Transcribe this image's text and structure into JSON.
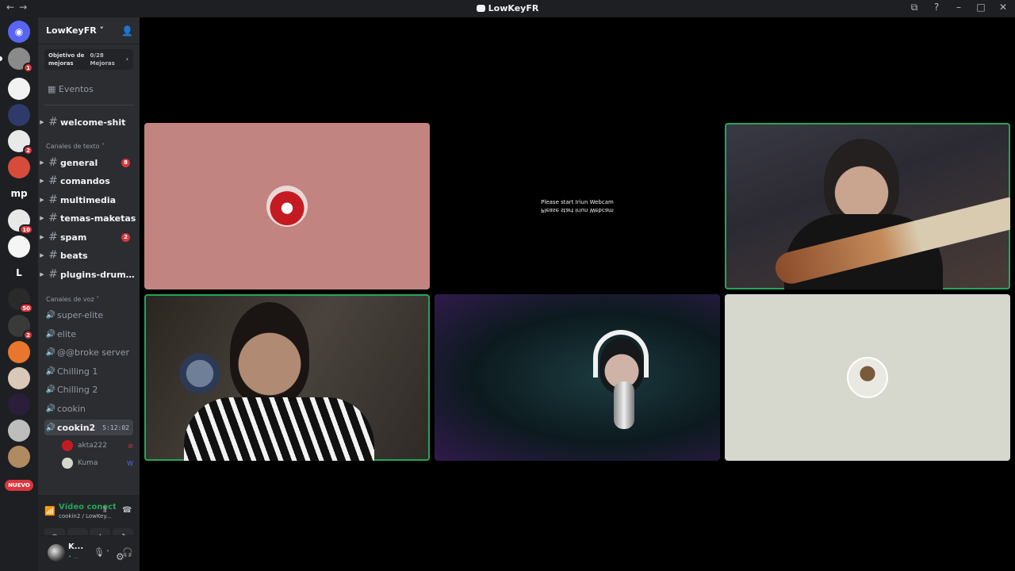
{
  "window": {
    "title": "LowKeyFR",
    "back": "←",
    "forward": "→",
    "controls": [
      "⧉",
      "?",
      "–",
      "□",
      "✕"
    ]
  },
  "guilds": [
    {
      "label": "",
      "color": "#5865f2",
      "icon": "discord-icon",
      "badge": ""
    },
    {
      "label": "",
      "color": "#8a8a8a",
      "badge": "1"
    },
    {
      "label": "",
      "color": "#f2f2f2",
      "badge": ""
    },
    {
      "label": "",
      "color": "#2d3a6a",
      "badge": ""
    },
    {
      "label": "",
      "color": "#e9e9e9",
      "badge": "2"
    },
    {
      "label": "",
      "color": "#d84a3a",
      "badge": ""
    },
    {
      "label": "mp",
      "color": "#1e1f22",
      "badge": ""
    },
    {
      "label": "",
      "color": "#e8e8e8",
      "badge": "10"
    },
    {
      "label": "",
      "color": "#f5f5f5",
      "badge": ""
    },
    {
      "label": "L",
      "color": "#1e1f22",
      "badge": ""
    },
    {
      "label": "",
      "color": "#2a2a2a",
      "badge": "50"
    },
    {
      "label": "",
      "color": "#3a3a3a",
      "badge": "2"
    },
    {
      "label": "",
      "color": "#e8762d",
      "badge": ""
    },
    {
      "label": "",
      "color": "#d9c8b8",
      "badge": ""
    },
    {
      "label": "",
      "color": "#2a1e3a",
      "badge": ""
    },
    {
      "label": "",
      "color": "#bdbdbd",
      "badge": ""
    },
    {
      "label": "",
      "color": "#b08a60",
      "badge": ""
    }
  ],
  "nuevo": "NUEVO",
  "server": {
    "name": "LowKeyFR ˅",
    "boost_goal": "Objetivo de mejoras",
    "boost_count": "0/28 Mejoras",
    "events": "Eventos"
  },
  "text_channels": {
    "top": {
      "name": "welcome-shit"
    },
    "category": "Canales de texto ˅",
    "items": [
      {
        "name": "general",
        "badge": "8"
      },
      {
        "name": "comandos",
        "badge": ""
      },
      {
        "name": "multimedia",
        "badge": ""
      },
      {
        "name": "temas-maketas",
        "badge": ""
      },
      {
        "name": "spam",
        "badge": "2"
      },
      {
        "name": "beats",
        "badge": ""
      },
      {
        "name": "plugins-drumkit...",
        "badge": ""
      }
    ]
  },
  "voice_channels": {
    "category": "Canales de voz ˅",
    "items": [
      {
        "name": "super-elite"
      },
      {
        "name": "elite"
      },
      {
        "name": "@@broke server"
      },
      {
        "name": "Chilling 1"
      },
      {
        "name": "Chilling 2"
      },
      {
        "name": "cookin"
      }
    ],
    "active": {
      "name": "cookin2",
      "time": "5:12:02"
    },
    "users": [
      {
        "name": "akta222",
        "color": "#c41b22"
      },
      {
        "name": "Kuma",
        "color": "#d6d7cd"
      }
    ]
  },
  "rtc": {
    "status": "Vídeo conectado",
    "sub": "cookin2 / LowKey..."
  },
  "user": {
    "name": "K...",
    "sub": "• ..."
  },
  "stage": {
    "webcam_message": "Please start Iriun Webcam"
  }
}
